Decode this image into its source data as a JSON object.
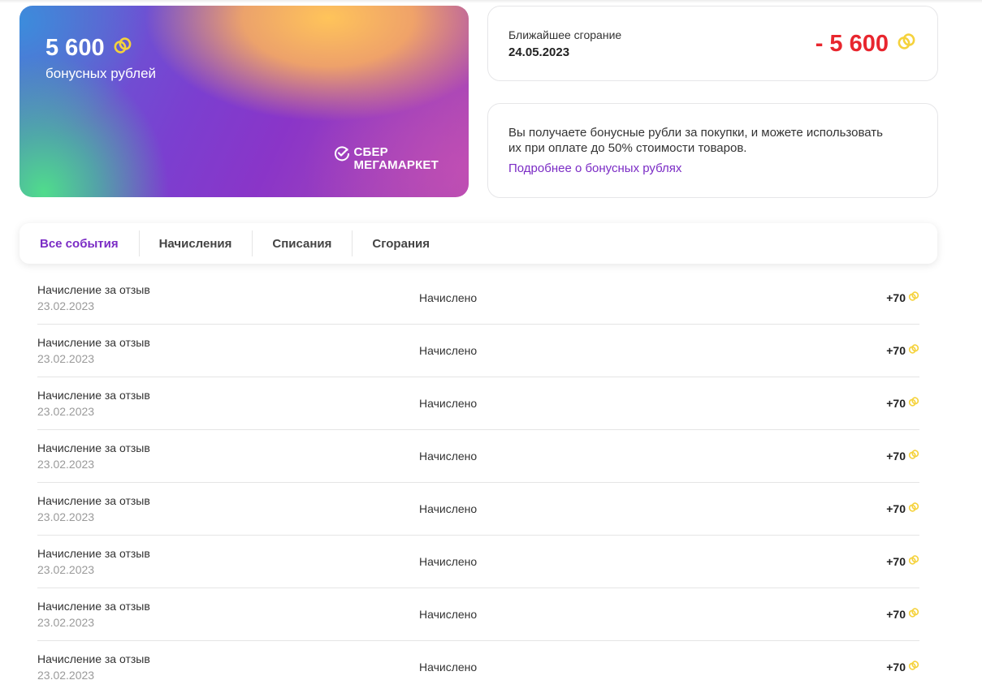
{
  "card": {
    "amount": "5 600",
    "caption": "бонусных рублей",
    "brand_line1": "СБЕР",
    "brand_line2": "МЕГАМАРКЕТ"
  },
  "expiration": {
    "label": "Ближайшее сгорание",
    "date": "24.05.2023",
    "amount": "- 5 600"
  },
  "info": {
    "text": "Вы получаете бонусные рубли за покупки, и можете использовать их при оплате до 50% стоимости товаров.",
    "link": "Подробнее о бонусных рублях"
  },
  "tabs": [
    {
      "label": "Все события",
      "active": true
    },
    {
      "label": "Начисления",
      "active": false
    },
    {
      "label": "Списания",
      "active": false
    },
    {
      "label": "Сгорания",
      "active": false
    }
  ],
  "events": [
    {
      "title": "Начисление за отзыв",
      "date": "23.02.2023",
      "status": "Начислено",
      "amount": "+70"
    },
    {
      "title": "Начисление за отзыв",
      "date": "23.02.2023",
      "status": "Начислено",
      "amount": "+70"
    },
    {
      "title": "Начисление за отзыв",
      "date": "23.02.2023",
      "status": "Начислено",
      "amount": "+70"
    },
    {
      "title": "Начисление за отзыв",
      "date": "23.02.2023",
      "status": "Начислено",
      "amount": "+70"
    },
    {
      "title": "Начисление за отзыв",
      "date": "23.02.2023",
      "status": "Начислено",
      "amount": "+70"
    },
    {
      "title": "Начисление за отзыв",
      "date": "23.02.2023",
      "status": "Начислено",
      "amount": "+70"
    },
    {
      "title": "Начисление за отзыв",
      "date": "23.02.2023",
      "status": "Начислено",
      "amount": "+70"
    },
    {
      "title": "Начисление за отзыв",
      "date": "23.02.2023",
      "status": "Начислено",
      "amount": "+70"
    }
  ],
  "colors": {
    "accent": "#7b2cc5",
    "negative": "#e8262e",
    "coin": "#f5d23c"
  },
  "icons": {
    "coin": "bonus-coin-icon",
    "brand": "sber-check-icon"
  }
}
